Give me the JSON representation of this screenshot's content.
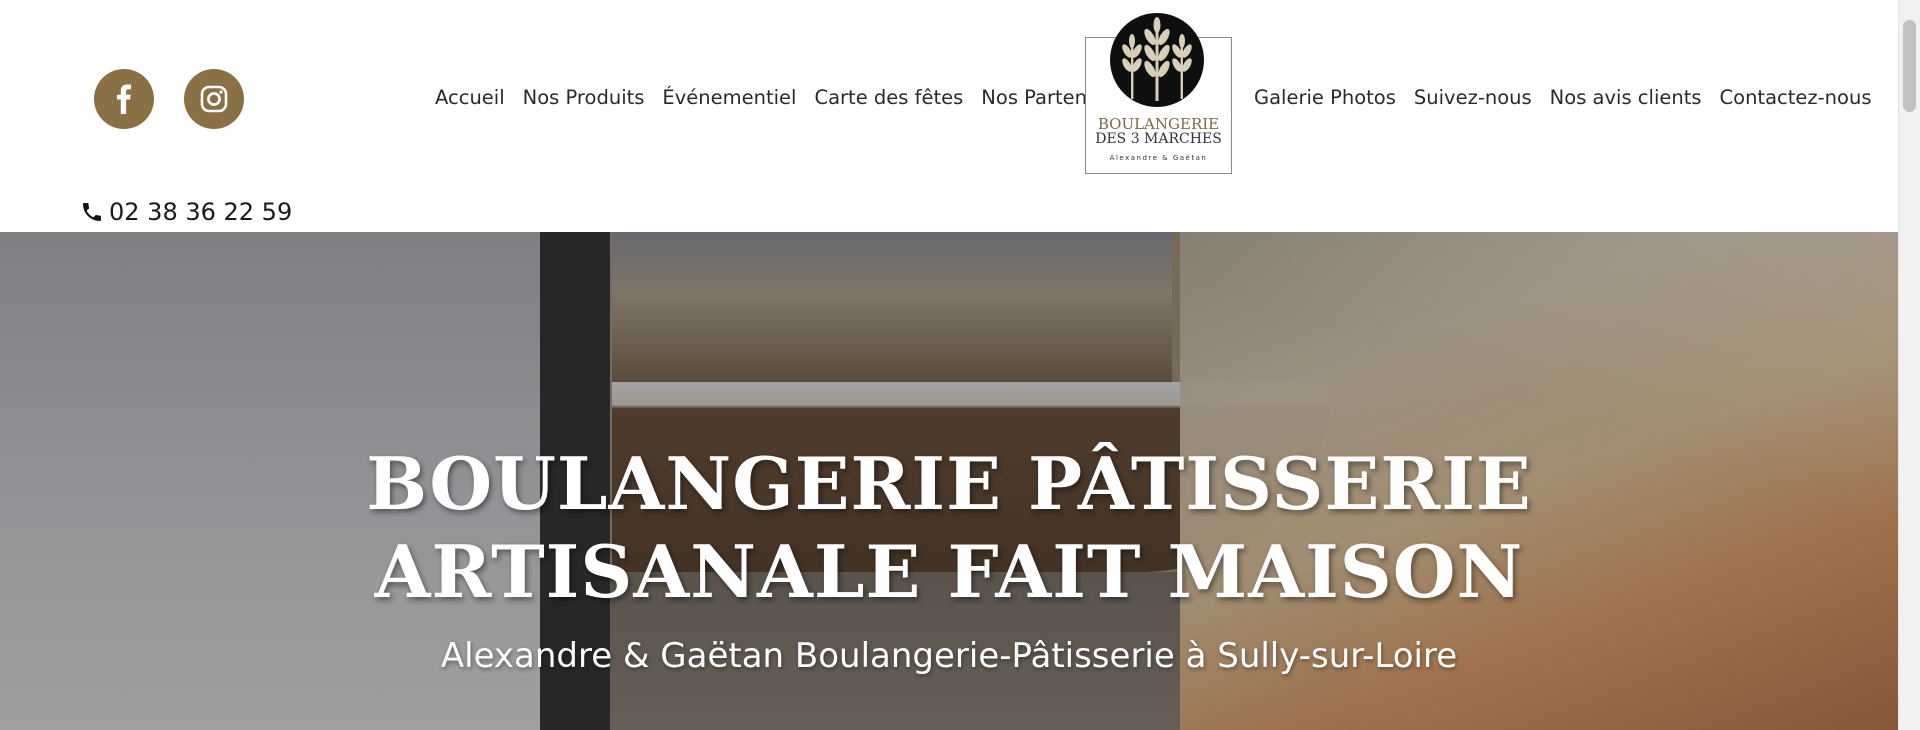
{
  "header": {
    "social": [
      {
        "icon": "facebook-icon"
      },
      {
        "icon": "instagram-icon"
      }
    ],
    "nav_left": [
      "Accueil",
      "Nos Produits",
      "Événementiel",
      "Carte des fêtes",
      "Nos Partenaires"
    ],
    "nav_right": [
      "Galerie Photos",
      "Suivez-nous",
      "Nos avis clients",
      "Contactez-nous"
    ],
    "logo": {
      "line1": "BOULANGERIE",
      "line2": "DES 3 MARCHES",
      "tagline": "Alexandre & Gaëtan"
    },
    "phone": "02 38 36 22 59"
  },
  "hero": {
    "title_line1": "BOULANGERIE PÂTISSERIE",
    "title_line2": "ARTISANALE FAIT MAISON",
    "subtitle": "Alexandre & Gaëtan Boulangerie-Pâtisserie à Sully-sur-Loire"
  },
  "colors": {
    "accent": "#8a7145",
    "text": "#2a2a2a"
  }
}
